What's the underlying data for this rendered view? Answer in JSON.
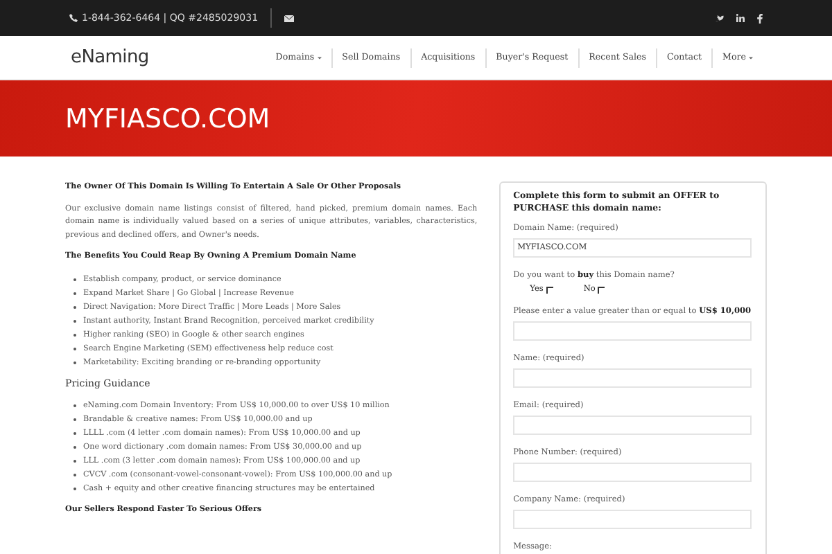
{
  "top_bar": {
    "phone": "1-844-362-6464 | QQ #2485029031"
  },
  "header": {
    "logo": "eNaming",
    "nav": [
      {
        "label": "Domains",
        "dropdown": true
      },
      {
        "label": "Sell Domains",
        "dropdown": false
      },
      {
        "label": "Acquisitions",
        "dropdown": false
      },
      {
        "label": "Buyer's Request",
        "dropdown": false
      },
      {
        "label": "Recent Sales",
        "dropdown": false
      },
      {
        "label": "Contact",
        "dropdown": false
      },
      {
        "label": "More",
        "dropdown": true
      }
    ]
  },
  "banner": {
    "title": "MYFIASCO.COM"
  },
  "content": [
    {
      "kind": "heading",
      "text": "The Owner Of This Domain Is Willing To Entertain A Sale Or Other Proposals"
    },
    {
      "kind": "paragraph",
      "text": "Our exclusive domain name listings consist of filtered, hand picked, premium domain names. Each domain name is individually valued based on a series of unique attributes, variables, characteristics, previous and declined offers, and Owner's needs."
    },
    {
      "kind": "heading",
      "text": "The Benefits You Could Reap By Owning A Premium Domain Name"
    },
    {
      "kind": "list",
      "items": [
        "Establish company, product, or service dominance",
        "Expand Market Share | Go Global | Increase Revenue",
        "Direct Navigation: More Direct Traffic | More Leads | More Sales",
        "Instant authority, Instant Brand Recognition, perceived market credibility",
        "Higher ranking (SEO) in Google & other search engines",
        "Search Engine Marketing (SEM) effectiveness help reduce cost",
        "Marketability: Exciting branding or re-branding opportunity"
      ]
    },
    {
      "kind": "subheading",
      "text": "Pricing Guidance"
    },
    {
      "kind": "list",
      "items": [
        "eNaming.com Domain Inventory: From US$ 10,000.00 to over US$ 10 million",
        "Brandable & creative names: From US$ 10,000.00 and up",
        "LLLL .com (4 letter .com domain names): From US$ 10,000.00 and up",
        "One word dictionary .com domain names: From US$ 30,000.00 and up",
        "LLL .com (3 letter .com domain names): From US$ 100,000.00 and up",
        "CVCV .com (consonant-vowel-consonant-vowel): From US$ 100,000.00 and up",
        "Cash + equity and other creative financing structures may be entertained"
      ]
    },
    {
      "kind": "heading",
      "text": "Our Sellers Respond Faster To Serious Offers"
    }
  ],
  "form": {
    "intro": "Complete this form to submit an OFFER to PURCHASE this domain name:",
    "fields": [
      {
        "kind": "text",
        "label": "Domain Name: (required)",
        "value": "MYFIASCO.COM"
      },
      {
        "kind": "choice",
        "label": "Do you want to **buy** this Domain name?",
        "options": [
          {
            "label": "Yes",
            "checked": false
          },
          {
            "label": "No",
            "checked": false
          }
        ]
      },
      {
        "kind": "text",
        "label": "Please enter a value greater than or equal to **US$ 10,000**"
      },
      {
        "kind": "text",
        "label": "Name: (required)"
      },
      {
        "kind": "text",
        "label": "Email: (required)"
      },
      {
        "kind": "text",
        "label": "Phone Number: (required)"
      },
      {
        "kind": "text",
        "label": "Company Name: (required)"
      },
      {
        "kind": "text",
        "label": "Message:"
      }
    ]
  }
}
